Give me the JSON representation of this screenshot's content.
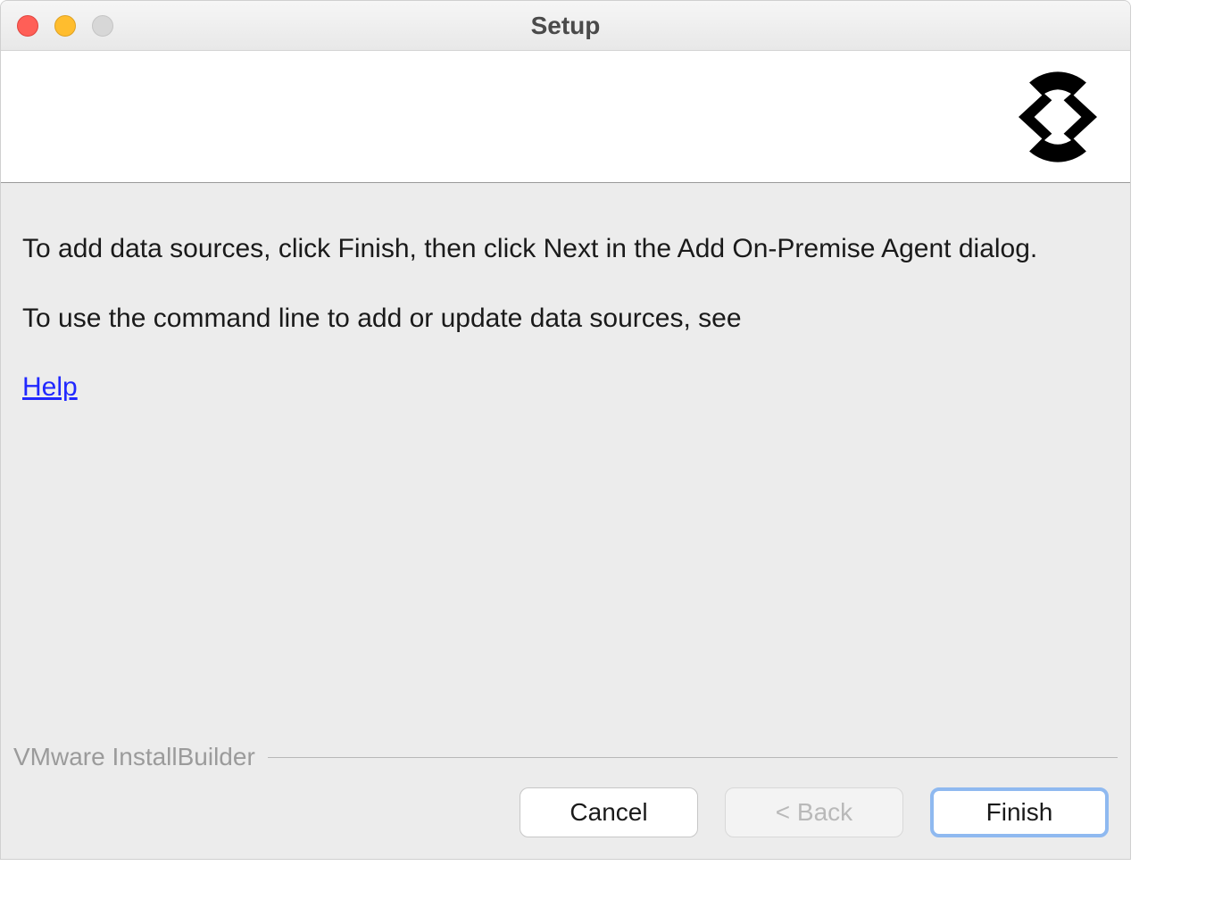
{
  "window": {
    "title": "Setup"
  },
  "content": {
    "para1": "To add data sources, click Finish, then click Next in the Add On-Premise Agent dialog.",
    "para2": "To use the command line to add or update data sources, see",
    "help_link": "Help"
  },
  "footer": {
    "brand": "VMware InstallBuilder"
  },
  "buttons": {
    "cancel": "Cancel",
    "back": "< Back",
    "finish": "Finish"
  }
}
